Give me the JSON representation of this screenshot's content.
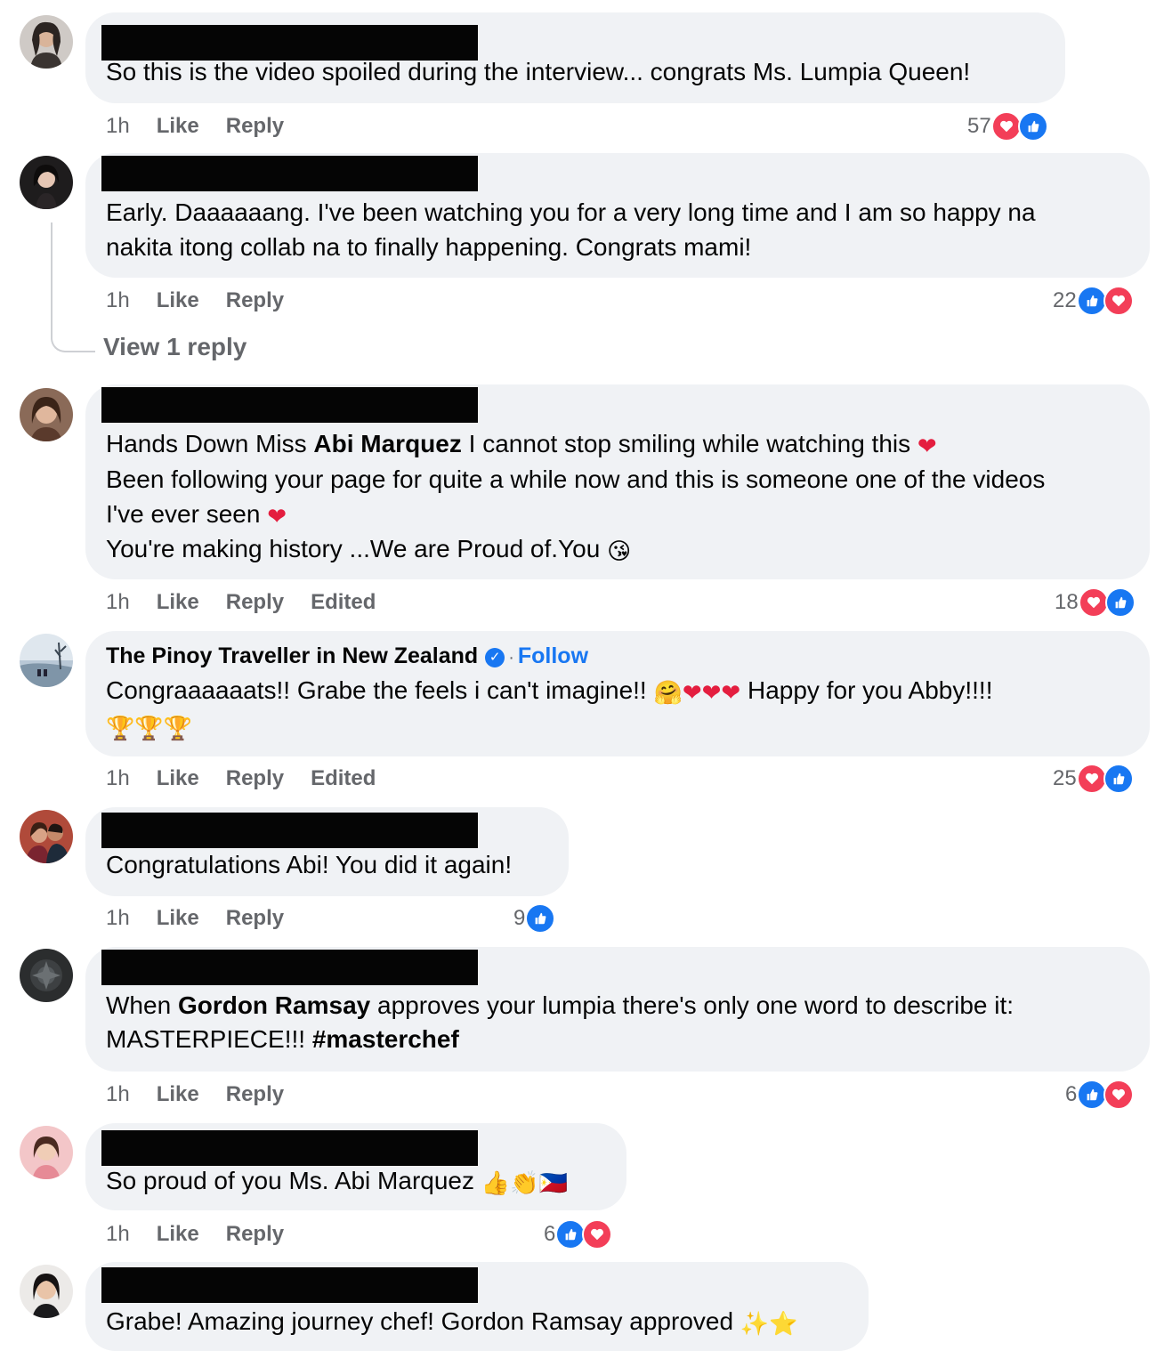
{
  "comments": [
    {
      "text": "So this is the video spoiled during the interview... congrats Ms. Lumpia Queen!",
      "time": "1h",
      "like": "Like",
      "reply": "Reply",
      "reaction_count": "57",
      "reactions": [
        "love-icon",
        "like-icon"
      ]
    },
    {
      "lines": [
        "Early. Daaaaaang. I've been watching you for a very long time and I am so happy na",
        "nakita itong collab na to finally happening. Congrats mami!"
      ],
      "time": "1h",
      "like": "Like",
      "reply": "Reply",
      "reaction_count": "22",
      "reactions": [
        "like-icon",
        "love-icon"
      ],
      "view_replies": "View 1 reply"
    },
    {
      "line1_pre": "Hands Down Miss ",
      "line1_bold": "Abi Marquez",
      "line1_post": " I cannot stop smiling while watching this ",
      "line2": "Been following your page for quite a while now and this is someone one of the videos",
      "line3": "I've ever seen ",
      "line4": "You're making history ...We are Proud of.You ",
      "time": "1h",
      "like": "Like",
      "reply": "Reply",
      "edited": "Edited",
      "reaction_count": "18",
      "reactions": [
        "love-icon",
        "like-icon"
      ]
    },
    {
      "author": "The Pinoy Traveller in New Zealand",
      "separator": "·",
      "follow": "Follow",
      "line1_pre": "Congraaaaaats!! Grabe the feels i can't imagine!! ",
      "line1_post": " Happy for you Abby!!!!",
      "time": "1h",
      "like": "Like",
      "reply": "Reply",
      "edited": "Edited",
      "reaction_count": "25",
      "reactions": [
        "love-icon",
        "like-icon"
      ]
    },
    {
      "text": "Congratulations Abi! You did it again!",
      "time": "1h",
      "like": "Like",
      "reply": "Reply",
      "reaction_count": "9",
      "reactions": [
        "like-icon"
      ]
    },
    {
      "line1_pre": "When ",
      "line1_bold": "Gordon Ramsay",
      "line1_post": " approves your lumpia there's only one word to describe it:",
      "line2_pre": "MASTERPIECE!!! ",
      "line2_bold": "#masterchef",
      "time": "1h",
      "like": "Like",
      "reply": "Reply",
      "reaction_count": "6",
      "reactions": [
        "like-icon",
        "love-icon"
      ]
    },
    {
      "text": "So proud of you Ms. Abi Marquez ",
      "time": "1h",
      "like": "Like",
      "reply": "Reply",
      "reaction_count": "6",
      "reactions": [
        "like-icon",
        "love-icon"
      ]
    },
    {
      "text": "Grabe! Amazing journey chef! Gordon Ramsay approved "
    }
  ],
  "colors": {
    "bubble": "#f0f2f5",
    "meta": "#65676b",
    "link": "#1877f2",
    "love": "#f33e58",
    "like": "#1877f2"
  }
}
